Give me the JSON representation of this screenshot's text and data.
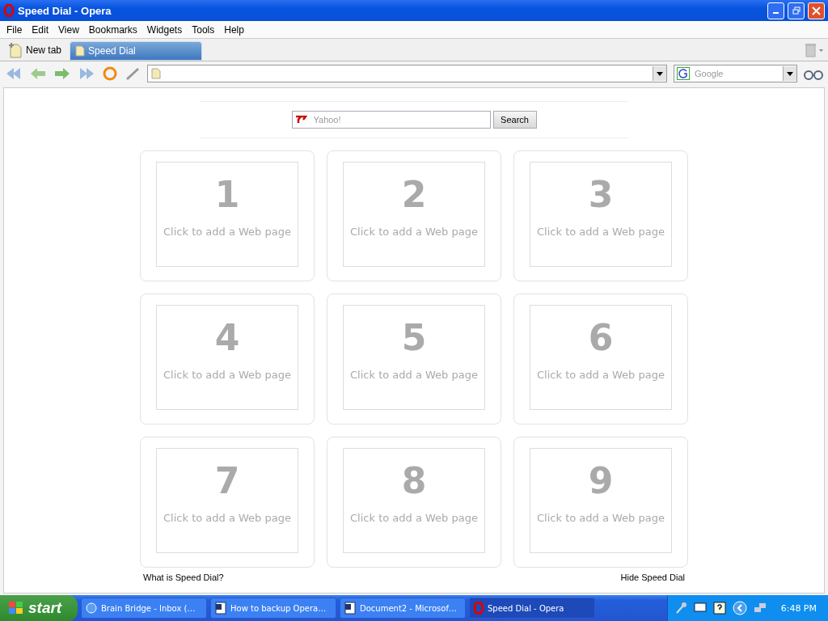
{
  "window": {
    "title": "Speed Dial - Opera"
  },
  "menu": [
    "File",
    "Edit",
    "View",
    "Bookmarks",
    "Widgets",
    "Tools",
    "Help"
  ],
  "tabs": [
    {
      "label": "New tab",
      "kind": "new",
      "selected": false
    },
    {
      "label": "Speed Dial",
      "kind": "page",
      "selected": true
    }
  ],
  "search_engine": {
    "placeholder": "Google"
  },
  "speed_dial": {
    "search": {
      "placeholder": "Yahoo!",
      "button": "Search"
    },
    "dials": [
      {
        "number": "1",
        "caption": "Click to add a Web page"
      },
      {
        "number": "2",
        "caption": "Click to add a Web page"
      },
      {
        "number": "3",
        "caption": "Click to add a Web page"
      },
      {
        "number": "4",
        "caption": "Click to add a Web page"
      },
      {
        "number": "5",
        "caption": "Click to add a Web page"
      },
      {
        "number": "6",
        "caption": "Click to add a Web page"
      },
      {
        "number": "7",
        "caption": "Click to add a Web page"
      },
      {
        "number": "8",
        "caption": "Click to add a Web page"
      },
      {
        "number": "9",
        "caption": "Click to add a Web page"
      }
    ],
    "links": [
      "What is Speed Dial?",
      "Hide Speed Dial"
    ]
  },
  "taskbar": {
    "start": "start",
    "tasks": [
      {
        "label": "Brain Bridge - Inbox (…",
        "kind": "ie",
        "selected": false
      },
      {
        "label": "How to backup Opera…",
        "kind": "word",
        "selected": false
      },
      {
        "label": "Document2 - Microsof…",
        "kind": "word",
        "selected": false
      },
      {
        "label": "Speed Dial - Opera",
        "kind": "opera",
        "selected": true
      }
    ],
    "clock": "6:48 PM"
  }
}
